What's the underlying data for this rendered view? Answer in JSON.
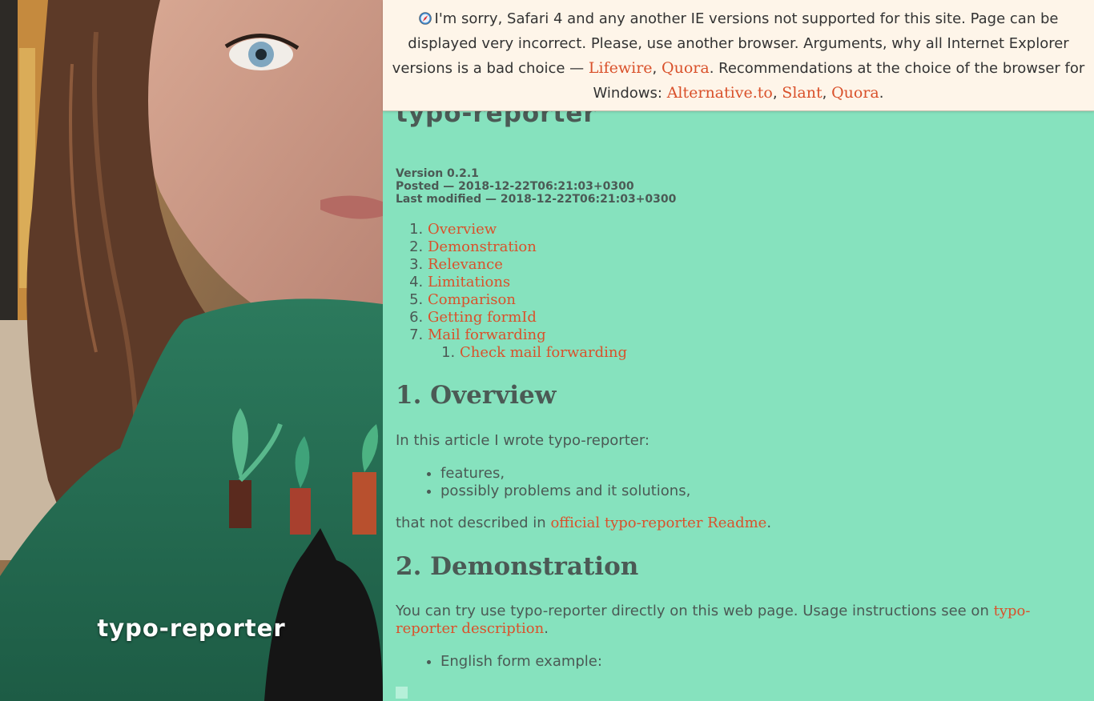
{
  "sidebar": {
    "title": "typo-reporter"
  },
  "warning": {
    "icon": "safari-icon",
    "text_1": "I'm sorry, Safari 4 and any another IE versions not supported for this site. Page can be displayed very incorrect. Please, use another browser. Arguments, why all Internet Explorer versions is a bad choice —",
    "link_lifewire": "Lifewire",
    "sep_1": ",",
    "link_quora_1": "Quora",
    "text_2": ". Recommendations at the choice of the browser for Windows:",
    "link_alternative": "Alternative.to",
    "sep_2": ",",
    "link_slant": "Slant",
    "sep_3": ",",
    "link_quora_2": "Quora",
    "end": "."
  },
  "article": {
    "title": "typo-reporter",
    "version": "Version 0.2.1",
    "posted": "Posted — 2018-12-22T06:21:03+0300",
    "modified": "Last modified — 2018-12-22T06:21:03+0300",
    "toc": [
      "Overview",
      "Demonstration",
      "Relevance",
      "Limitations",
      "Comparison",
      "Getting formId",
      "Mail forwarding"
    ],
    "toc_sub": [
      "Check mail forwarding"
    ],
    "overview": {
      "heading": "1. Overview",
      "intro": "In this article I wrote typo-reporter:",
      "items": [
        "features,",
        "possibly problems and it solutions,"
      ],
      "outro_text": "that not described in",
      "outro_link": "official typo-reporter Readme",
      "outro_end": "."
    },
    "demonstration": {
      "heading": "2. Demonstration",
      "text": "You can try use typo-reporter directly on this web page. Usage instructions see on",
      "link": "typo-reporter description",
      "end": ".",
      "items": [
        "English form example:"
      ]
    }
  },
  "colors": {
    "background": "#86e2be",
    "link": "#d9512b",
    "banner": "#fef5e9"
  }
}
